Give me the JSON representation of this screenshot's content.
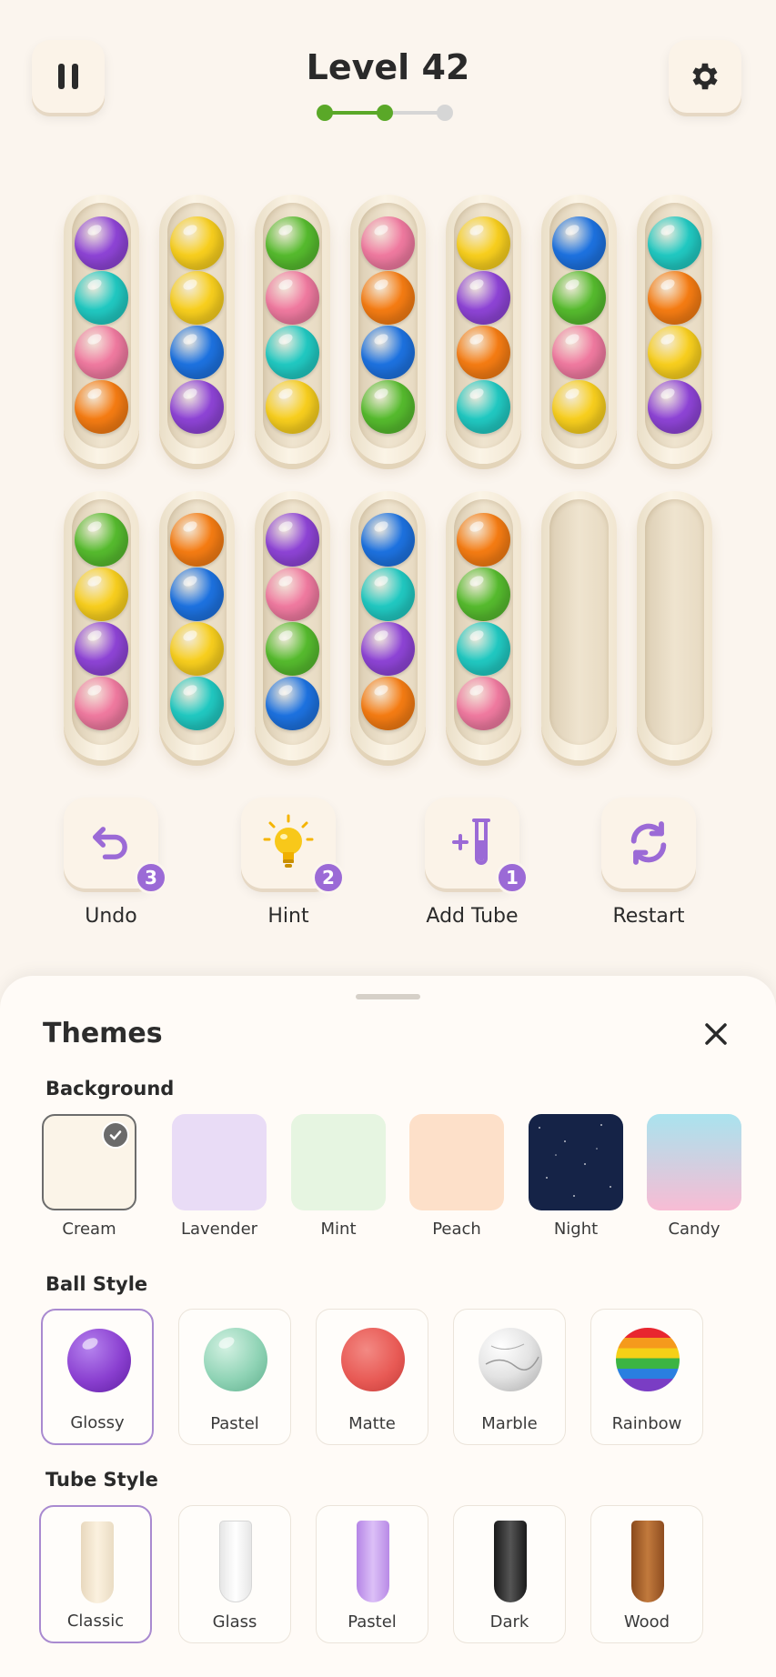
{
  "header": {
    "level_title": "Level 42",
    "progress": {
      "completed_steps": 2,
      "total_steps": 3
    }
  },
  "colors": {
    "purple": "#8e44d6",
    "cyan": "#21c9c2",
    "pink": "#f07aa0",
    "orange": "#f57c13",
    "yellow": "#f8cf1e",
    "blue": "#1d72e0",
    "green": "#56bb2e",
    "accent": "#9b6ad6",
    "progress_done": "#5aa828",
    "progress_todo": "#d6d6d6"
  },
  "tubes": [
    [
      "purple",
      "cyan",
      "pink",
      "orange"
    ],
    [
      "yellow",
      "yellow",
      "blue",
      "purple"
    ],
    [
      "green",
      "pink",
      "cyan",
      "yellow"
    ],
    [
      "pink",
      "orange",
      "blue",
      "green"
    ],
    [
      "yellow",
      "purple",
      "orange",
      "cyan"
    ],
    [
      "blue",
      "green",
      "pink",
      "yellow"
    ],
    [
      "cyan",
      "orange",
      "yellow",
      "purple"
    ],
    [
      "green",
      "yellow",
      "purple",
      "pink"
    ],
    [
      "orange",
      "blue",
      "yellow",
      "cyan"
    ],
    [
      "purple",
      "pink",
      "green",
      "blue"
    ],
    [
      "blue",
      "cyan",
      "purple",
      "orange"
    ],
    [
      "orange",
      "green",
      "cyan",
      "pink"
    ],
    [],
    []
  ],
  "powerups": [
    {
      "label": "Undo",
      "count": "3",
      "icon": "undo-icon"
    },
    {
      "label": "Hint",
      "count": "2",
      "icon": "lightbulb-icon"
    },
    {
      "label": "Add Tube",
      "count": "1",
      "icon": "add-tube-icon"
    },
    {
      "label": "Restart",
      "count": "",
      "icon": "restart-icon"
    }
  ],
  "themes": {
    "title": "Themes",
    "background": {
      "title": "Background",
      "selected": "Cream",
      "options": [
        {
          "label": "Cream",
          "color": "#fbf4e8"
        },
        {
          "label": "Lavender",
          "color": "#e9dcf6"
        },
        {
          "label": "Mint",
          "color": "#e6f5e1"
        },
        {
          "label": "Peach",
          "color": "#fde0c9"
        },
        {
          "label": "Night",
          "color": "#152347"
        },
        {
          "label": "Candy",
          "color": "#a9e3ee"
        }
      ]
    },
    "ball_style": {
      "title": "Ball Style",
      "selected": "Glossy",
      "options": [
        {
          "label": "Glossy",
          "color": "#8a3fd0"
        },
        {
          "label": "Pastel",
          "color": "#8fd3b5"
        },
        {
          "label": "Matte",
          "color": "#e85a55"
        },
        {
          "label": "Marble",
          "color": "#d9d9d9"
        },
        {
          "label": "Rainbow",
          "color": "#f5b400"
        }
      ]
    },
    "tube_style": {
      "title": "Tube Style",
      "selected": "Classic",
      "options": [
        {
          "label": "Classic",
          "color": "#f3e6cf"
        },
        {
          "label": "Glass",
          "color": "#f2f2f2"
        },
        {
          "label": "Pastel",
          "color": "#c79bf0"
        },
        {
          "label": "Dark",
          "color": "#2a2a2a"
        },
        {
          "label": "Wood",
          "color": "#a8612a"
        }
      ]
    }
  }
}
